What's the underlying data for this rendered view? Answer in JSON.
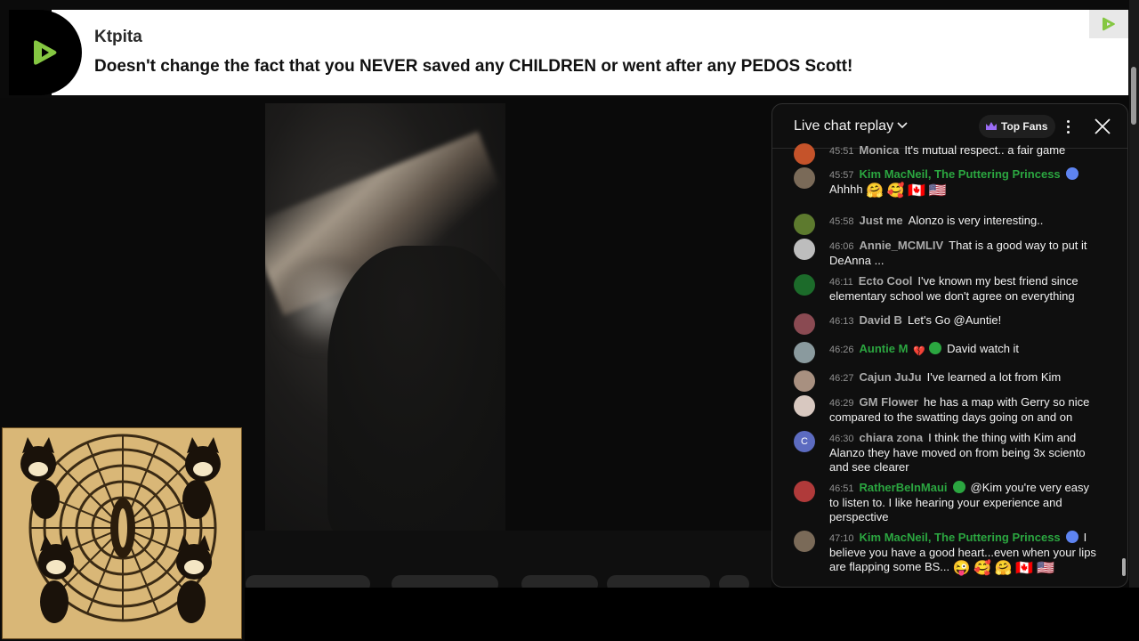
{
  "banner": {
    "username": "Ktpita",
    "message": "Doesn't change the fact that you NEVER saved any CHILDREN or went after any PEDOS Scott!"
  },
  "chat": {
    "title": "Live chat replay",
    "top_fans_label": "Top Fans",
    "messages": [
      {
        "time": "45:51",
        "author": "Monica",
        "text": "It's mutual respect.. a fair game"
      },
      {
        "time": "45:57",
        "author": "Kim MacNeil, The Puttering Princess",
        "text": "Ahhhh",
        "emojis": [
          "🤗",
          "🥰",
          "🇨🇦",
          "🇺🇸"
        ]
      },
      {
        "time": "45:58",
        "author": "Just me",
        "text": "Alonzo is very interesting.."
      },
      {
        "time": "46:06",
        "author": "Annie_MCMLIV",
        "text": "That is a good way to put it DeAnna ..."
      },
      {
        "time": "46:11",
        "author": "Ecto Cool",
        "text": "I've known my best friend since elementary school we don't agree on everything"
      },
      {
        "time": "46:13",
        "author": "David B",
        "text": "Let's Go @Auntie!"
      },
      {
        "time": "46:26",
        "author": "Auntie M",
        "text": "David watch it",
        "emojis": [
          "💔"
        ]
      },
      {
        "time": "46:27",
        "author": "Cajun JuJu",
        "text": "I've learned a lot from Kim"
      },
      {
        "time": "46:29",
        "author": "GM Flower",
        "text": "he has a map with Gerry so nice compared to the swatting days going on and on"
      },
      {
        "time": "46:30",
        "author": "chiara zona",
        "avatar_letter": "C",
        "text": "I think the thing with Kim and Alanzo they have moved on from being 3x sciento and see clearer"
      },
      {
        "time": "46:51",
        "author": "RatherBeInMaui",
        "text": "@Kim you're very easy to listen to. I like hearing your experience and perspective"
      },
      {
        "time": "47:10",
        "author": "Kim MacNeil, The Puttering Princess",
        "text": "I believe you have a good heart...even when your lips are flapping some BS...",
        "emojis": [
          "😜",
          "🥰",
          "🤗",
          "🇨🇦",
          "🇺🇸"
        ]
      }
    ]
  },
  "colors": {
    "accent_green": "#2ba640",
    "member_badge_blue": "#5e84f1",
    "chat_bg": "#0f0f0f",
    "art_bg": "#d9b777"
  },
  "icons": [
    "rumble-logo-icon",
    "chevron-down-icon",
    "crown-icon",
    "more-vert-icon",
    "close-icon",
    "verified-badge-icon"
  ]
}
